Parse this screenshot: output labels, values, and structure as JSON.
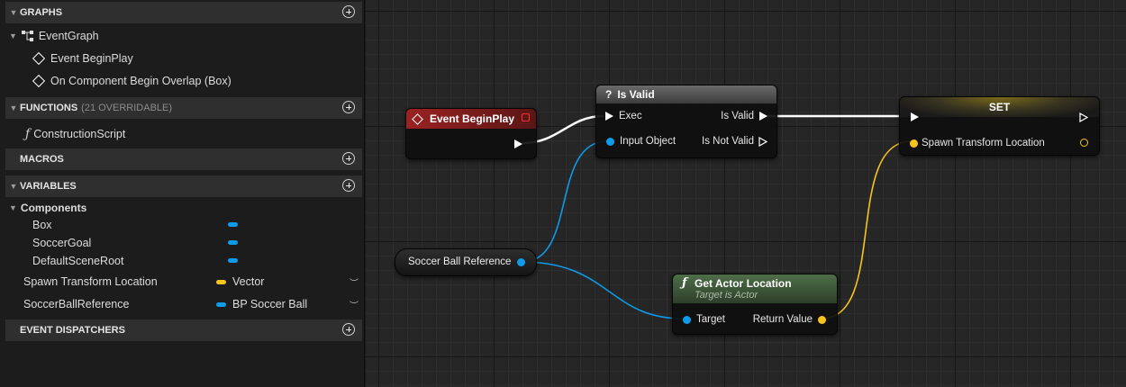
{
  "sidebar": {
    "graphs": {
      "title": "GRAPHS",
      "event_graph": "EventGraph",
      "events": [
        "Event BeginPlay",
        "On Component Begin Overlap (Box)"
      ]
    },
    "functions": {
      "title": "FUNCTIONS",
      "count": "(21 OVERRIDABLE)",
      "items": [
        "ConstructionScript"
      ]
    },
    "macros": {
      "title": "MACROS"
    },
    "variables": {
      "title": "VARIABLES",
      "components_label": "Components",
      "components": [
        "Box",
        "SoccerGoal",
        "DefaultSceneRoot"
      ],
      "vars": [
        {
          "name": "Spawn Transform Location",
          "type": "Vector",
          "color": "#f7c41f"
        },
        {
          "name": "SoccerBallReference",
          "type": "BP Soccer Ball",
          "color": "#0d9bea"
        }
      ]
    },
    "dispatchers": {
      "title": "EVENT DISPATCHERS"
    }
  },
  "graph": {
    "begin_play": {
      "title": "Event BeginPlay"
    },
    "is_valid": {
      "title": "Is Valid",
      "exec": "Exec",
      "input_object": "Input Object",
      "is_valid": "Is Valid",
      "is_not_valid": "Is Not Valid"
    },
    "set": {
      "title": "SET",
      "pin": "Spawn Transform Location"
    },
    "soccer_ref": {
      "label": "Soccer Ball Reference"
    },
    "get_location": {
      "title": "Get Actor Location",
      "subtitle": "Target is Actor",
      "target": "Target",
      "return_value": "Return Value"
    }
  },
  "colors": {
    "object_pin": "#0d9bea",
    "vector_pin": "#f7c41f",
    "event_header": "#8b1d1d",
    "pure_header": "#3e5a3a"
  }
}
